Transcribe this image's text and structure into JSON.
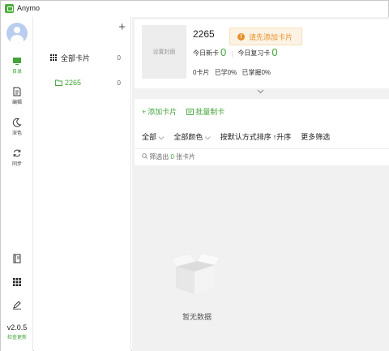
{
  "window": {
    "title": "Anymo"
  },
  "nav": {
    "items": [
      {
        "label": "目录",
        "icon": "monitor-icon",
        "active": true
      },
      {
        "label": "编辑",
        "icon": "document-icon",
        "active": false
      },
      {
        "label": "深色",
        "icon": "moon-icon",
        "active": false
      },
      {
        "label": "同步",
        "icon": "sync-icon",
        "active": false
      }
    ],
    "bottom_icons": [
      "book-icon",
      "apps-grid-icon",
      "pen-icon"
    ],
    "version": "v2.0.5",
    "check_update": "检查更新"
  },
  "decks": {
    "add_label": "+",
    "all": {
      "name": "全部卡片",
      "count": "0"
    },
    "items": [
      {
        "name": "2265",
        "count": "0"
      }
    ]
  },
  "deck_header": {
    "cover_label": "设置封面",
    "title": "2265",
    "warning": "请先添加卡片",
    "today_new_label": "今日新卡",
    "today_new_value": "0",
    "today_review_label": "今日复习卡",
    "today_review_value": "0",
    "cards": "0卡片",
    "learned": "已学0%",
    "mastered": "已掌握0%"
  },
  "toolbar": {
    "add_card": "添加卡片",
    "batch_create": "批量制卡"
  },
  "filters": {
    "all": "全部",
    "all_colors": "全部颜色",
    "sort": "按默认方式排序",
    "order": "升序",
    "more": "更多筛选"
  },
  "result": {
    "prefix": "筛选出",
    "count": "0",
    "suffix": "张卡片"
  },
  "empty": {
    "text": "暂无数据"
  },
  "colors": {
    "accent": "#43a33a",
    "warning": "#e5902b"
  }
}
